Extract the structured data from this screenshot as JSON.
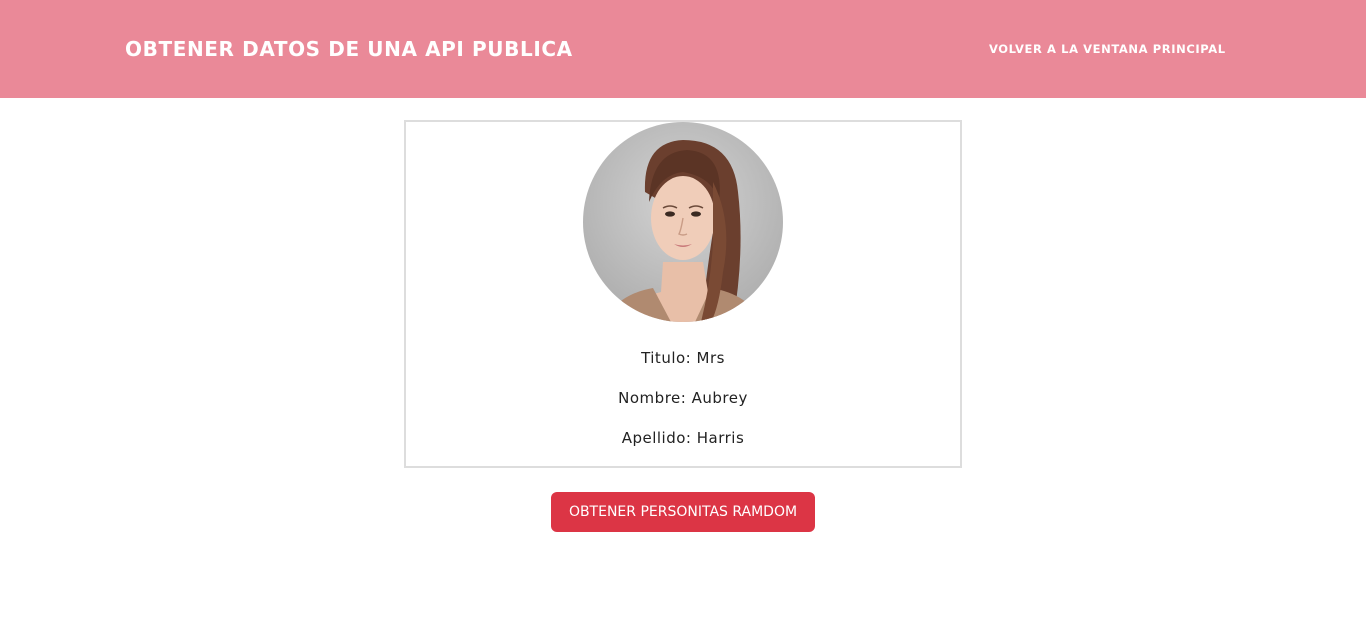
{
  "header": {
    "title": "OBTENER DATOS DE UNA API PUBLICA",
    "back_link": "VOLVER A LA VENTANA PRINCIPAL",
    "background_color": "#ea8998"
  },
  "person_card": {
    "avatar_icon": "person-portrait",
    "titulo_label": "Titulo:",
    "titulo_value": "Mrs",
    "nombre_label": "Nombre:",
    "nombre_value": "Aubrey",
    "apellido_label": "Apellido:",
    "apellido_value": "Harris"
  },
  "actions": {
    "fetch_button_label": "OBTENER PERSONITAS RAMDOM",
    "fetch_button_color": "#dc3545"
  }
}
